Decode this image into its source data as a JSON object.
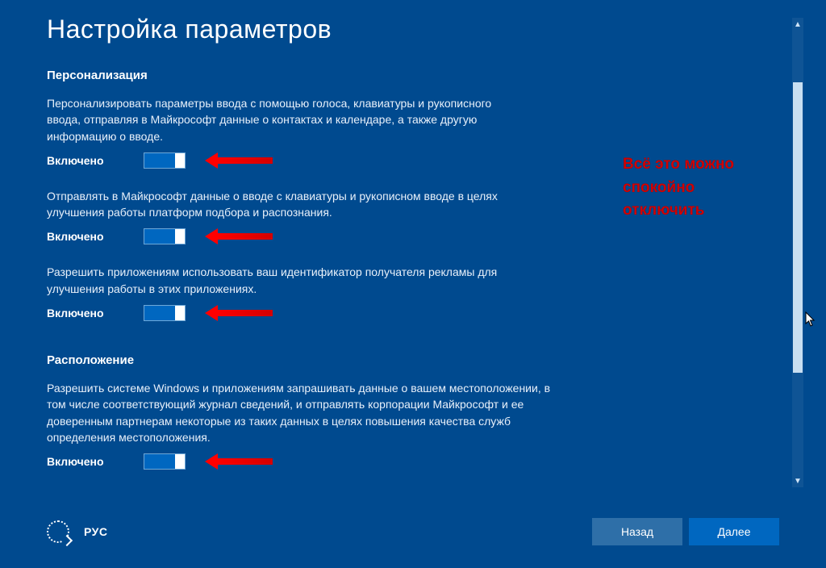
{
  "title": "Настройка параметров",
  "sections": [
    {
      "heading": "Персонализация",
      "options": [
        {
          "desc": "Персонализировать параметры ввода с помощью голоса, клавиатуры и рукописного ввода, отправляя в Майкрософт данные о контактах и календаре, а также другую информацию о вводе.",
          "state": "Включено"
        },
        {
          "desc": "Отправлять в Майкрософт данные о вводе с клавиатуры и рукописном вводе в целях улучшения работы платформ подбора и распознания.",
          "state": "Включено"
        },
        {
          "desc": "Разрешить приложениям использовать ваш идентификатор получателя рекламы для улучшения работы в этих приложениях.",
          "state": "Включено"
        }
      ]
    },
    {
      "heading": "Расположение",
      "options": [
        {
          "desc": "Разрешить системе Windows и приложениям запрашивать данные о вашем местоположении, в том числе соответствующий журнал сведений, и отправлять корпорации Майкрософт и ее доверенным партнерам некоторые из таких данных в целях повышения качества служб определения местоположения.",
          "state": "Включено"
        }
      ]
    }
  ],
  "annotation": "Всё это можно спокойно отключить",
  "bottom": {
    "lang": "РУС",
    "back": "Назад",
    "next": "Далее"
  }
}
